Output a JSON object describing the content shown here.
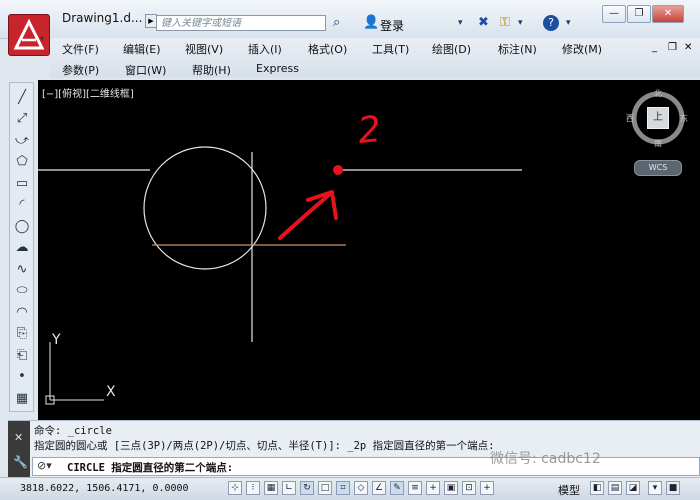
{
  "titlebar": {
    "document_title": "Drawing1.d...",
    "search_placeholder": "键入关键字或短语",
    "login_label": "登录"
  },
  "menu": {
    "row1": [
      "文件(F)",
      "编辑(E)",
      "视图(V)",
      "插入(I)",
      "格式(O)",
      "工具(T)",
      "绘图(D)",
      "标注(N)",
      "修改(M)"
    ],
    "row2": [
      "参数(P)",
      "窗口(W)",
      "帮助(H)",
      "Express"
    ]
  },
  "viewport": {
    "label": "[−][俯视][二维线框]",
    "navcube": {
      "north": "北",
      "south": "南",
      "east": "东",
      "west": "西",
      "top": "上"
    },
    "wcs_label": "WCS",
    "ucs_x": "X",
    "ucs_y": "Y",
    "annotation_number": "2"
  },
  "command": {
    "line1": "命令:  _circle",
    "line2": "指定圆的圆心或 [三点(3P)/两点(2P)/切点、切点、半径(T)]: _2p 指定圆直径的第一个端点:",
    "input_text": "CIRCLE 指定圆直径的第二个端点:"
  },
  "status": {
    "coordinates": "3818.6022, 1506.4171, 0.0000",
    "model_label": "模型"
  },
  "watermark": "微信号: cadbc12",
  "colors": {
    "canvas": "#000000",
    "annotation": "#e8121b",
    "geometry": "#e6e6e6",
    "tracking_line": "#c8906a"
  },
  "icons": {
    "left_toolbar": [
      "line-icon",
      "construction-line-icon",
      "polyline-icon",
      "polygon-icon",
      "rectangle-icon",
      "arc-icon",
      "circle-icon",
      "revision-cloud-icon",
      "spline-icon",
      "ellipse-icon",
      "ellipse-arc-icon",
      "insert-block-icon",
      "make-block-icon",
      "point-icon",
      "hatch-icon"
    ]
  }
}
